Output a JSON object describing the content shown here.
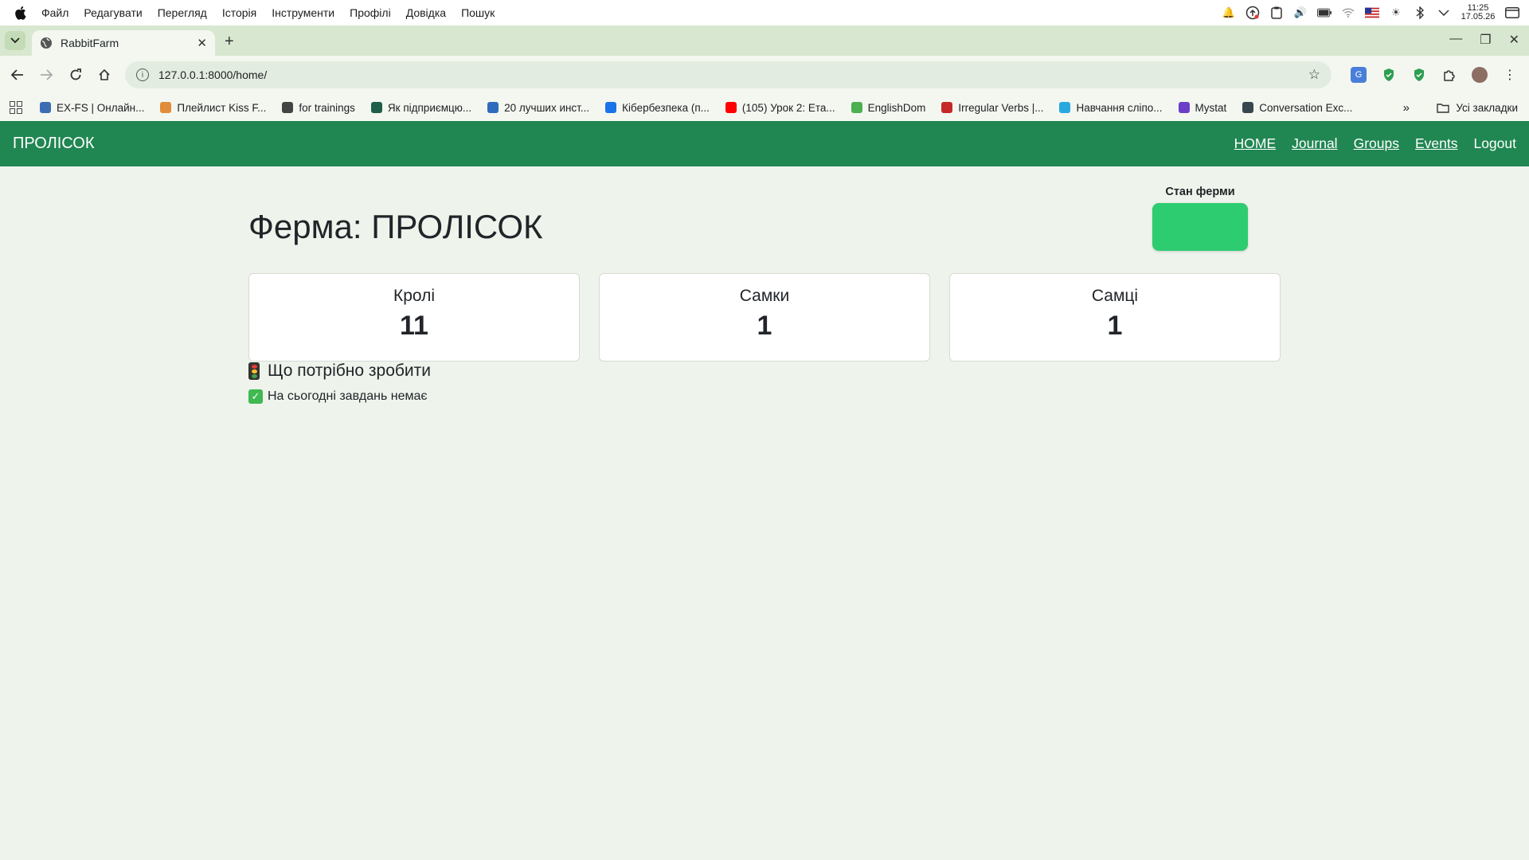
{
  "os_menubar": {
    "items": [
      "Файл",
      "Редагувати",
      "Перегляд",
      "Історія",
      "Інструменти",
      "Профілі",
      "Довідка",
      "Пошук"
    ],
    "clock_time": "11:25",
    "clock_date": "17.05.26"
  },
  "browser": {
    "tab_title": "RabbitFarm",
    "url": "127.0.0.1:8000/home/",
    "bookmarks": [
      {
        "label": "EX-FS | Онлайн...",
        "icon": "arrow-up-icon",
        "color": "#3b6db3"
      },
      {
        "label": "Плейлист Kiss F...",
        "icon": "box-icon",
        "color": "#e28b3a"
      },
      {
        "label": "for trainings",
        "icon": "globe-icon",
        "color": "#444444"
      },
      {
        "label": "Як підприємцю...",
        "icon": "ei-icon",
        "color": "#1f5f4a"
      },
      {
        "label": "20 лучших инст...",
        "icon": "chart-icon",
        "color": "#2f6bbd"
      },
      {
        "label": "Кібербезпека (п...",
        "icon": "c-icon",
        "color": "#1a73e8"
      },
      {
        "label": "(105) Урок 2: Ета...",
        "icon": "youtube-icon",
        "color": "#ff0000"
      },
      {
        "label": "EnglishDom",
        "icon": "ed-icon",
        "color": "#4caf50"
      },
      {
        "label": "Irregular Verbs |...",
        "icon": "e-icon",
        "color": "#c62828"
      },
      {
        "label": "Навчання сліпо...",
        "icon": "ratatype-icon",
        "color": "#29a8e0"
      },
      {
        "label": "Mystat",
        "icon": "m-icon",
        "color": "#6c3fc9"
      },
      {
        "label": "Conversation Exc...",
        "icon": "ce-icon",
        "color": "#37474f"
      }
    ],
    "all_bookmarks_label": "Усі закладки"
  },
  "site": {
    "brand": "ПРОЛІСОК",
    "nav": [
      "HOME",
      "Journal",
      "Groups",
      "Events",
      "Logout"
    ],
    "title": "Ферма: ПРОЛІСОК",
    "farm_status_label": "Стан ферми",
    "farm_status_color": "#2ecc71",
    "stats": [
      {
        "label": "Кролі",
        "value": "11"
      },
      {
        "label": "Самки",
        "value": "1"
      },
      {
        "label": "Самці",
        "value": "1"
      }
    ],
    "todo_heading": "Що потрібно зробити",
    "todo_empty": "На сьогодні завдань немає"
  }
}
